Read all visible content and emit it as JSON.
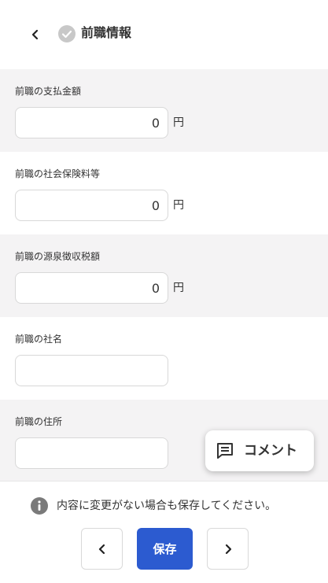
{
  "header": {
    "title": "前職情報",
    "back_icon": "chevron-left-icon",
    "status_icon": "check-circle-icon"
  },
  "fields": [
    {
      "label": "前職の支払金額",
      "value": "0",
      "unit": "円"
    },
    {
      "label": "前職の社会保険料等",
      "value": "0",
      "unit": "円"
    },
    {
      "label": "前職の源泉徴収税額",
      "value": "0",
      "unit": "円"
    },
    {
      "label": "前職の社名",
      "value": ""
    },
    {
      "label": "前職の住所",
      "value": ""
    }
  ],
  "comment_button": {
    "label": "コメント",
    "icon": "comment-icon"
  },
  "footer": {
    "notice": "内容に変更がない場合も保存してください。",
    "notice_icon": "info-icon",
    "save_label": "保存",
    "prev_icon": "chevron-left-icon",
    "next_icon": "chevron-right-icon"
  },
  "colors": {
    "primary": "#2c5bd0",
    "section_gray": "#f4f3f4",
    "check_gray": "#c8c8c8"
  }
}
